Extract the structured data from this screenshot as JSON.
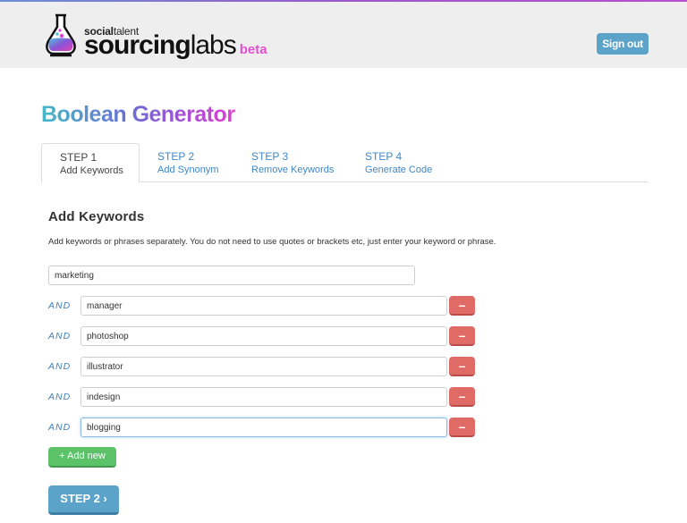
{
  "brand": {
    "small_bold": "social",
    "small_regular": "talent",
    "big_bold": "sourcing",
    "big_regular": "labs",
    "beta": "beta"
  },
  "header": {
    "signout_label": "Sign out"
  },
  "page": {
    "title": "Boolean Generator"
  },
  "tabs": [
    {
      "step": "STEP 1",
      "label": "Add Keywords",
      "active": true
    },
    {
      "step": "STEP 2",
      "label": "Add Synonym",
      "active": false
    },
    {
      "step": "STEP 3",
      "label": "Remove Keywords",
      "active": false
    },
    {
      "step": "STEP 4",
      "label": "Generate Code",
      "active": false
    }
  ],
  "section": {
    "title": "Add Keywords",
    "help": "Add keywords or phrases separately. You do not need to use quotes or brackets etc, just enter your keyword or phrase."
  },
  "keywords": {
    "first": "marketing",
    "operator": "AND",
    "rows": [
      "manager",
      "photoshop",
      "illustrator",
      "indesign",
      "blogging"
    ],
    "remove_symbol": "–"
  },
  "buttons": {
    "add_new": "+ Add new",
    "next": "STEP 2 ›"
  },
  "colors": {
    "primary": "#5ba3c8",
    "danger": "#e06a66",
    "success": "#5cc26a",
    "link": "#3f87c7",
    "beta": "#e44fd1"
  }
}
